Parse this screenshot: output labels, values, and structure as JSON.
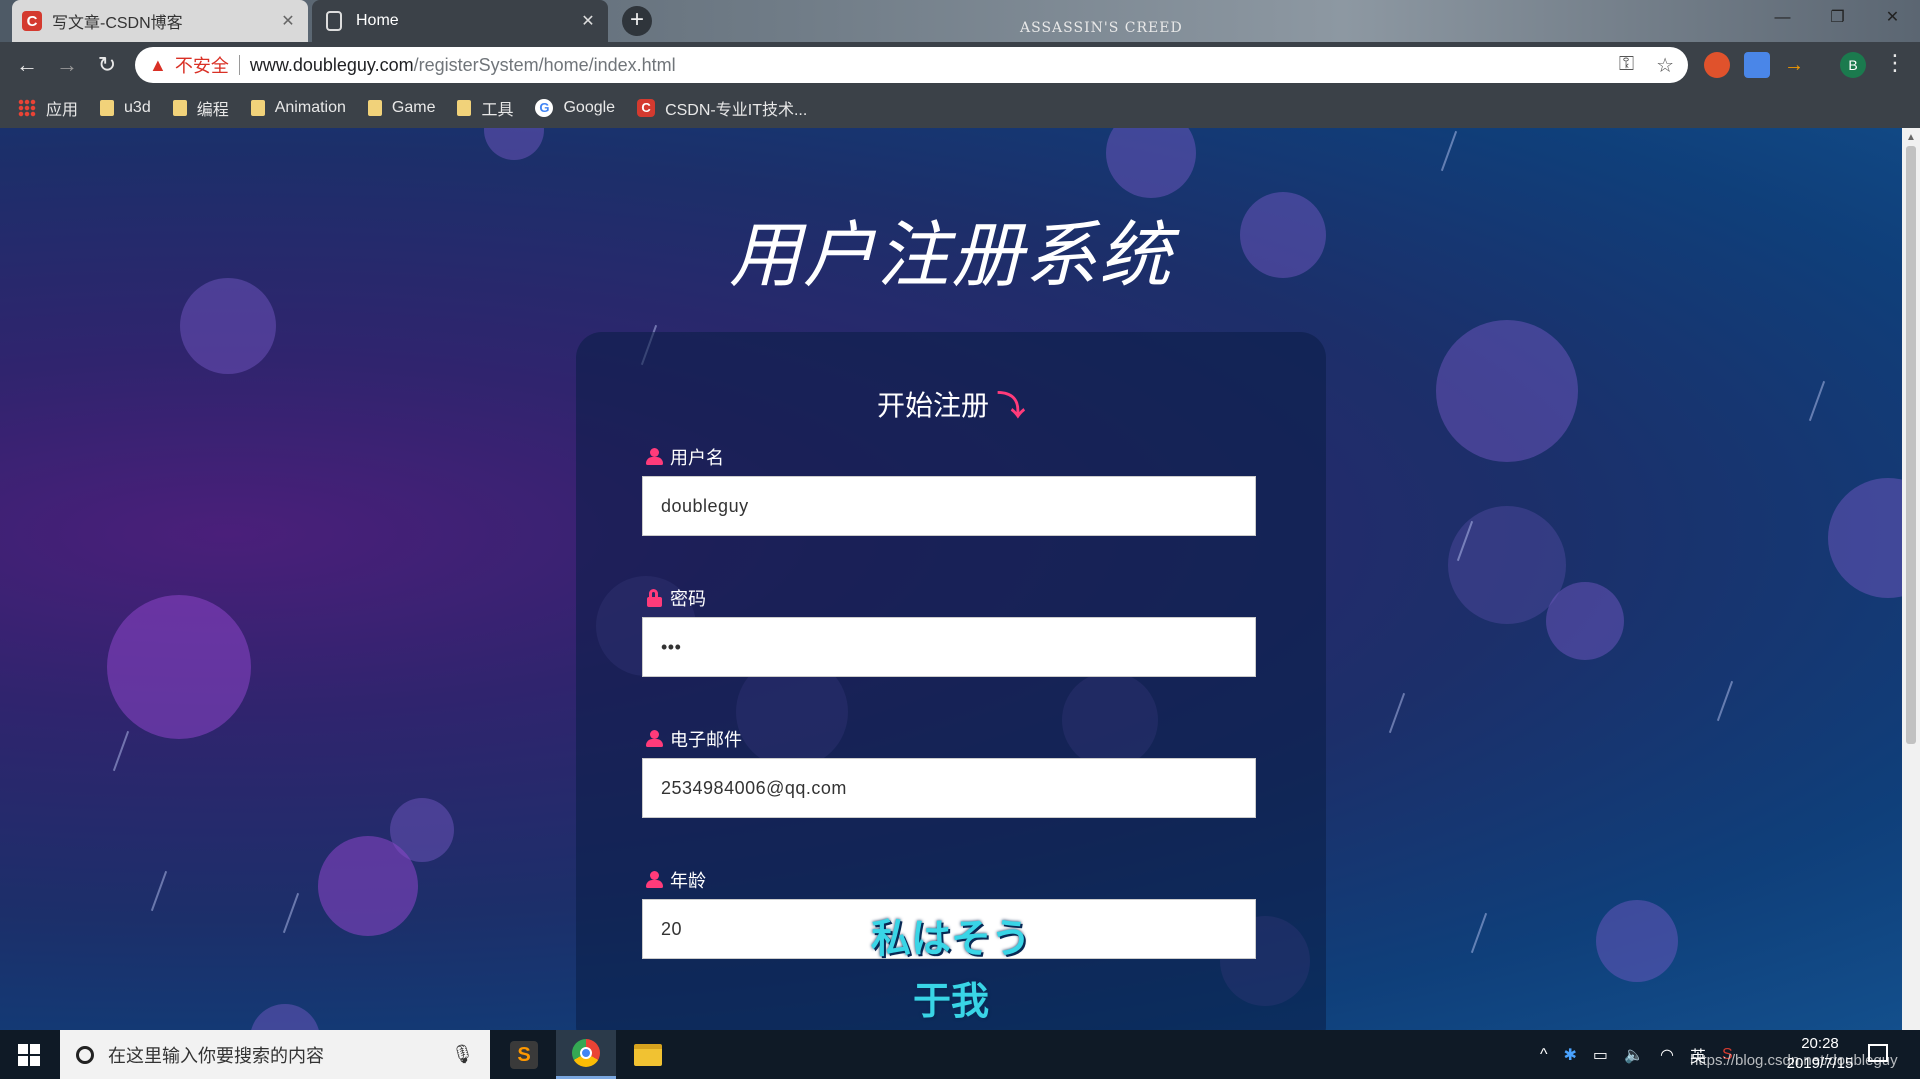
{
  "browser": {
    "tabs": [
      {
        "title": "写文章-CSDN博客",
        "favicon": "csdn-icon",
        "active": false
      },
      {
        "title": "Home",
        "favicon": "document-icon",
        "active": true
      }
    ],
    "new_tab_label": "+",
    "brand_text": "ASSASSIN'S CREED",
    "address": {
      "security_label": "不安全",
      "host": "www.doubleguy.com",
      "path": "/registerSystem/home/index.html"
    },
    "profile_initial": "B",
    "bookmarks": [
      {
        "label": "应用",
        "icon": "apps-icon"
      },
      {
        "label": "u3d",
        "icon": "folder-icon"
      },
      {
        "label": "编程",
        "icon": "folder-icon"
      },
      {
        "label": "Animation",
        "icon": "folder-icon"
      },
      {
        "label": "Game",
        "icon": "folder-icon"
      },
      {
        "label": "工具",
        "icon": "folder-icon"
      },
      {
        "label": "Google",
        "icon": "google-icon"
      },
      {
        "label": "CSDN-专业IT技术...",
        "icon": "csdn-icon"
      }
    ]
  },
  "page": {
    "title": "用户注册系统",
    "form": {
      "heading": "开始注册",
      "fields": [
        {
          "label": "用户名",
          "value": "doubleguy",
          "icon": "user-icon"
        },
        {
          "label": "密码",
          "value": "•••",
          "icon": "lock-icon"
        },
        {
          "label": "电子邮件",
          "value": "2534984006@qq.com",
          "icon": "user-icon"
        },
        {
          "label": "年龄",
          "value": "20",
          "icon": "user-icon"
        }
      ]
    },
    "subtitles": [
      "私はそう",
      "于我"
    ]
  },
  "taskbar": {
    "search_placeholder": "在这里输入你要搜索的内容",
    "apps": [
      "sublime-text",
      "chrome",
      "file-explorer"
    ],
    "tray_ime": "英",
    "time": "20:28",
    "date": "2019/7/15",
    "watermark": "https://blog.csdn.net/doubleguy"
  },
  "colors": {
    "accent_pink": "#ff3b7a",
    "subtitle_cyan": "#39d5e6",
    "toolbar": "#3b4148"
  }
}
